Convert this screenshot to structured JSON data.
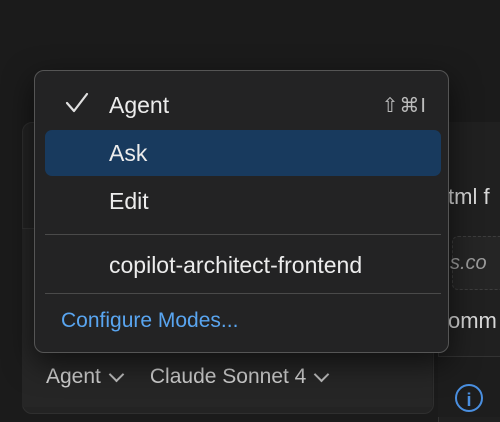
{
  "background": {
    "right_title": "tml f",
    "right_italic": "s.co",
    "right_text2": "omm",
    "info_icon": "i"
  },
  "toolbar": {
    "mode_label": "Agent",
    "model_label": "Claude Sonnet 4"
  },
  "menu": {
    "items": [
      {
        "label": "Agent",
        "checked": true,
        "shortcut": "⇧⌘I"
      },
      {
        "label": "Ask",
        "selected": true
      },
      {
        "label": "Edit"
      }
    ],
    "custom_modes": [
      {
        "label": "copilot-architect-frontend"
      }
    ],
    "configure_label": "Configure Modes..."
  },
  "colors": {
    "selected_bg": "#183a5e",
    "link": "#59a5f0",
    "menu_bg": "#232324",
    "info_icon": "#4a8fe0"
  }
}
